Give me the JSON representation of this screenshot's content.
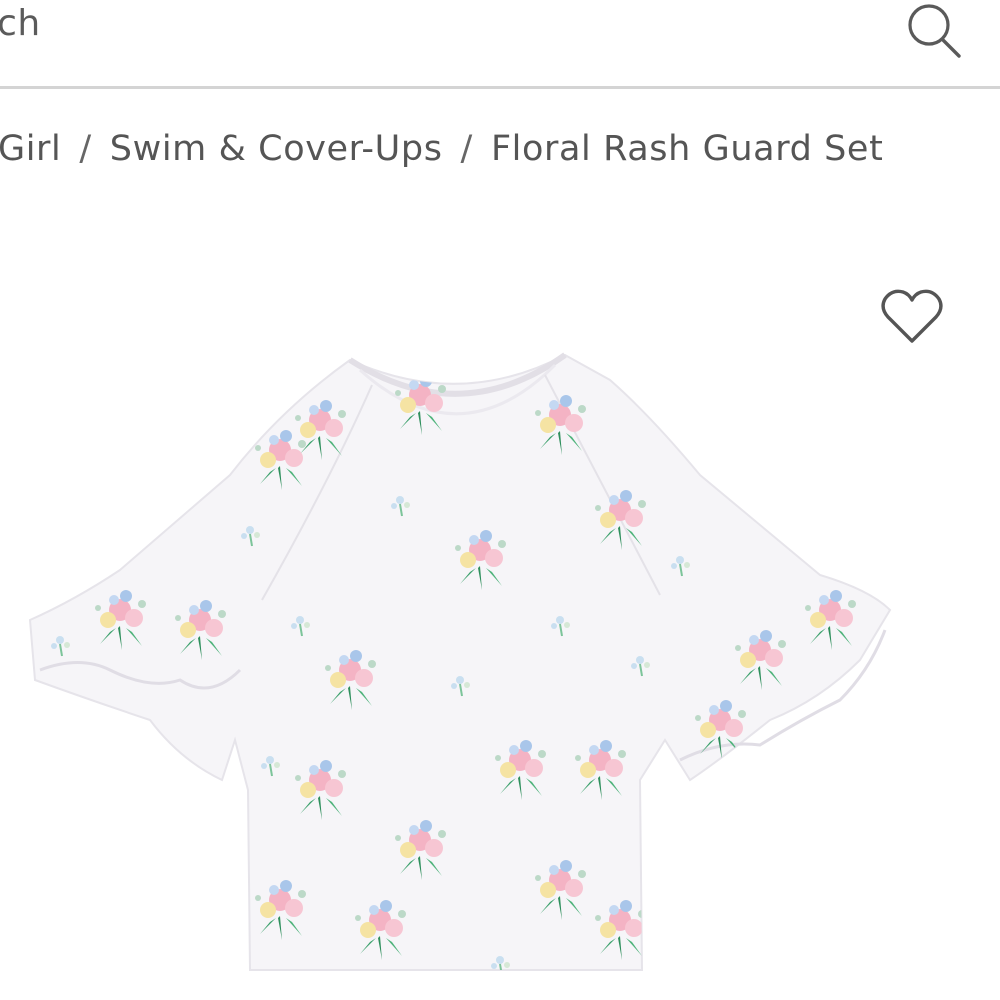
{
  "search": {
    "text": "arch",
    "icon": "search-icon"
  },
  "breadcrumb": {
    "items": [
      "Girl",
      "Swim & Cover-Ups",
      "Floral Rash Guard Set"
    ],
    "separator": "/"
  },
  "product": {
    "image": "floral rash guard top",
    "wishlist_icon": "heart-outline-icon"
  },
  "colors": {
    "text": "#555555",
    "divider": "#d4d4d4",
    "shirt": "#f6f5f8",
    "floral_pink": "#f4b3c4",
    "floral_green": "#3aa06a",
    "floral_blue": "#a9c6ea",
    "floral_yellow": "#f5e3a3"
  }
}
